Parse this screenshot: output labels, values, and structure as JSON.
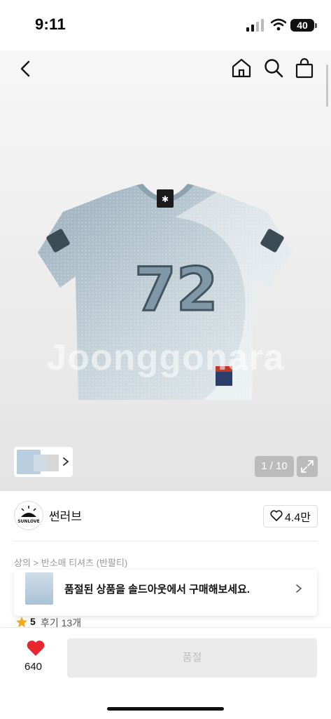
{
  "status_bar": {
    "time": "9:11",
    "battery": "40"
  },
  "gallery": {
    "watermark": "Joonggonara",
    "image_counter": "1 / 10",
    "jersey_number": "72"
  },
  "brand": {
    "name": "썬러브",
    "like_count": "4.4만",
    "logo_text": "SUNLOVE"
  },
  "breadcrumb": "상의 > 반소매 티셔츠 (반팔티)",
  "soldout_banner": {
    "text": "품절된 상품을 솔드아웃에서 구매해보세요."
  },
  "rating": {
    "value": "5",
    "reviews": "후기 13개"
  },
  "bottom_bar": {
    "like_count": "640",
    "action_label": "품절"
  },
  "colors": {
    "accent_red": "#e8262f",
    "star": "#f2a91c",
    "jersey": "#8fa6b4"
  }
}
